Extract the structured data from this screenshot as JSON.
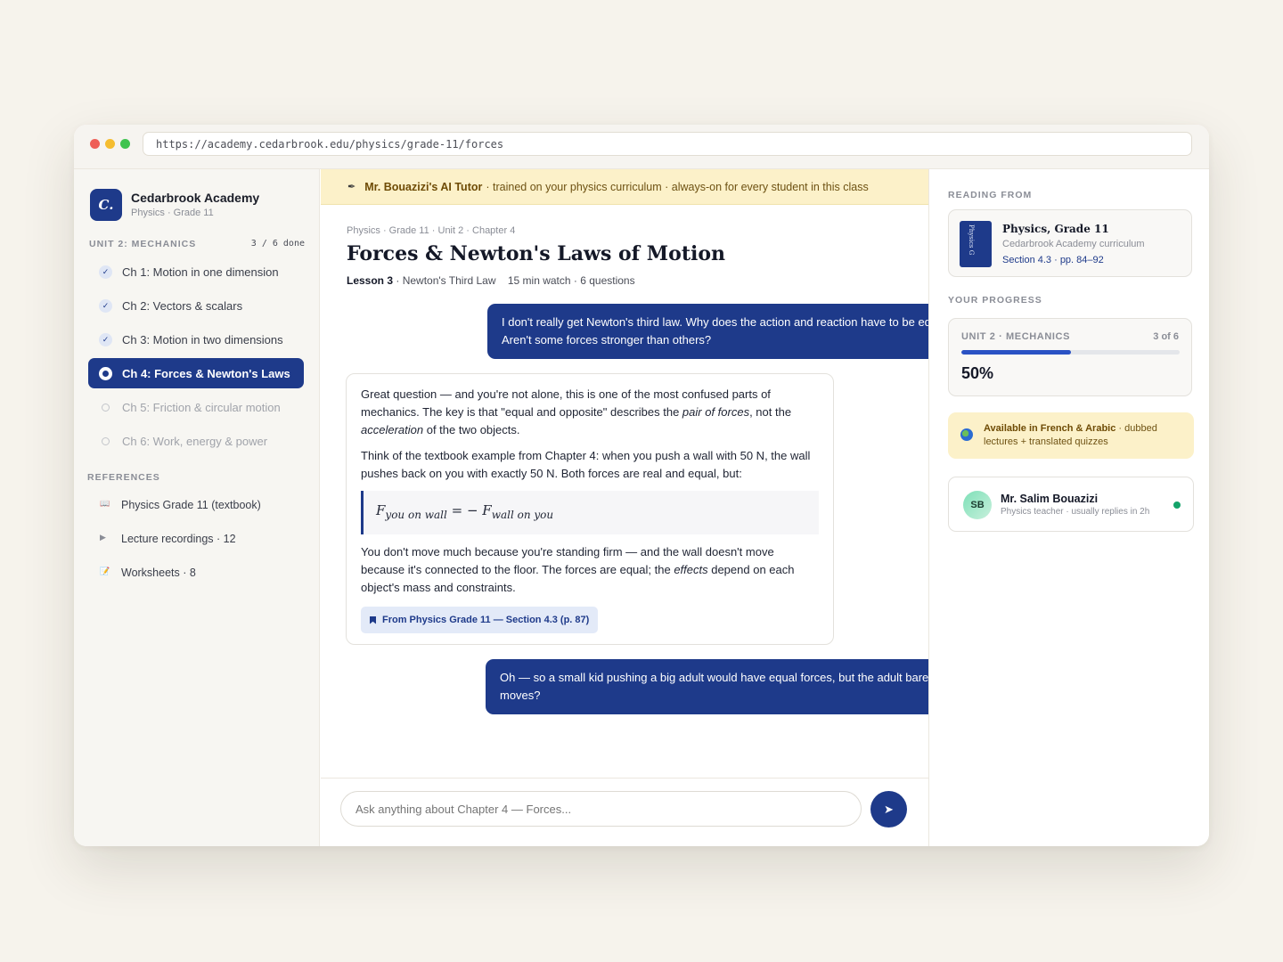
{
  "browser": {
    "url": "https://academy.cedarbrook.edu/physics/grade-11/forces"
  },
  "brand": {
    "logo": "C.",
    "name": "Cedarbrook Academy",
    "subtitle": "Physics · Grade 11"
  },
  "sidebar": {
    "unit_label": "UNIT 2: MECHANICS",
    "unit_count": "3 / 6 done",
    "chapters": [
      {
        "label": "Ch 1: Motion in one dimension",
        "state": "done"
      },
      {
        "label": "Ch 2: Vectors & scalars",
        "state": "done"
      },
      {
        "label": "Ch 3: Motion in two dimensions",
        "state": "done"
      },
      {
        "label": "Ch 4: Forces & Newton's Laws",
        "state": "active"
      },
      {
        "label": "Ch 5: Friction & circular motion",
        "state": "locked"
      },
      {
        "label": "Ch 6: Work, energy & power",
        "state": "locked"
      }
    ],
    "references_label": "REFERENCES",
    "references": [
      {
        "icon": "book-icon",
        "glyph": "📖",
        "label": "Physics Grade 11 (textbook)"
      },
      {
        "icon": "play-icon",
        "glyph": "▶",
        "label": "Lecture recordings · 12"
      },
      {
        "icon": "pencil-icon",
        "glyph": "📝",
        "label": "Worksheets · 8"
      }
    ]
  },
  "banner": {
    "icon": "pen-icon",
    "title": "Mr. Bouazizi's AI Tutor",
    "text": "· trained on your physics curriculum · always-on for every student in this class"
  },
  "lesson": {
    "breadcrumb": "Physics · Grade 11 · Unit 2 · Chapter 4",
    "title": "Forces & Newton's Laws of Motion",
    "lesson_num": "Lesson 3",
    "lesson_name": "· Newton's Third Law",
    "duration": "15 min watch · 6 questions"
  },
  "chat": {
    "user_1": "I don't really get Newton's third law. Why does the action and reaction have to be equal? Aren't some forces stronger than others?",
    "ai": {
      "p1_a": "Great question — and you're not alone, this is one of the most confused parts of mechanics. The key is that \"equal and opposite\" describes the ",
      "p1_em1": "pair of forces",
      "p1_b": ", not the ",
      "p1_em2": "acceleration",
      "p1_c": " of the two objects.",
      "p2": "Think of the textbook example from Chapter 4: when you push a wall with 50 N, the wall pushes back on you with exactly 50 N. Both forces are real and equal, but:",
      "eq_f1": "F",
      "eq_sub1": "you on wall",
      "eq_mid": " = − F",
      "eq_sub2": "wall on you",
      "p3_a": "You don't move much because you're standing firm — and the wall doesn't move because it's connected to the floor. The forces are equal; the ",
      "p3_em": "effects",
      "p3_b": " depend on each object's mass and constraints.",
      "citation": "From Physics Grade 11 — Section 4.3 (p. 87)"
    },
    "user_2": "Oh — so a small kid pushing a big adult would have equal forces, but the adult barely moves?",
    "input_placeholder": "Ask anything about Chapter 4 — Forces...",
    "send_icon": "send-icon",
    "send_glyph": "➤"
  },
  "rail": {
    "reading_label": "READING FROM",
    "book": {
      "spine": "Physics G",
      "title": "Physics, Grade 11",
      "subtitle": "Cedarbrook Academy curriculum",
      "section": "Section 4.3 · pp. 84–92"
    },
    "progress_label": "YOUR PROGRESS",
    "progress": {
      "unit": "UNIT 2 · MECHANICS",
      "count": "3 of 6",
      "percent_text": "50%",
      "fraction": 0.5
    },
    "language": {
      "highlight": "Available in French & Arabic",
      "rest": " · dubbed lectures + translated quizzes"
    },
    "teacher": {
      "initials": "SB",
      "name": "Mr. Salim Bouazizi",
      "subtitle": "Physics teacher · usually replies in 2h"
    }
  },
  "colors": {
    "brand": "#1e3a8a",
    "banner": "#fcf1c9",
    "online": "#14a36a"
  }
}
